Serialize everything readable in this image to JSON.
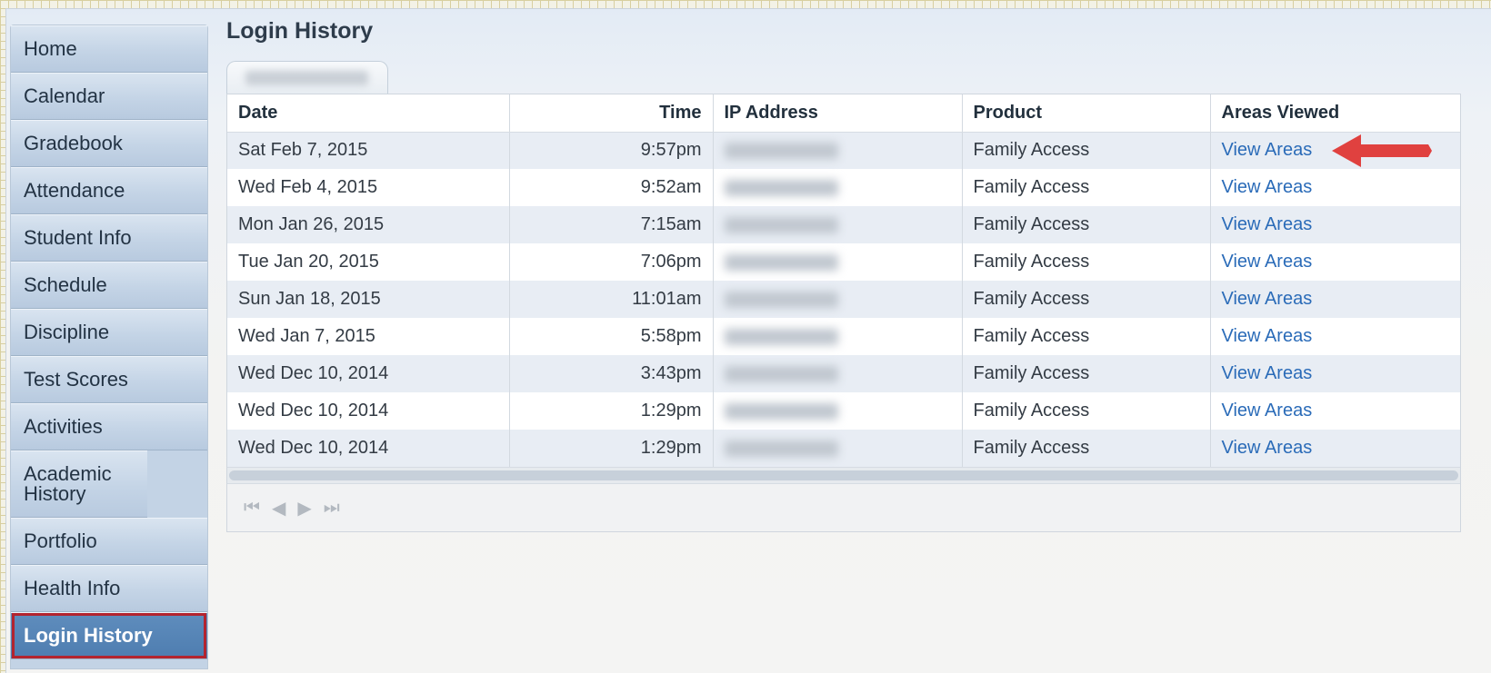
{
  "sidebar": {
    "items": [
      {
        "label": "Home"
      },
      {
        "label": "Calendar"
      },
      {
        "label": "Gradebook"
      },
      {
        "label": "Attendance"
      },
      {
        "label": "Student Info"
      },
      {
        "label": "Schedule"
      },
      {
        "label": "Discipline"
      },
      {
        "label": "Test Scores"
      },
      {
        "label": "Activities"
      },
      {
        "label": "Academic History"
      },
      {
        "label": "Portfolio"
      },
      {
        "label": "Health Info"
      },
      {
        "label": "Login History"
      }
    ],
    "active_item": "Login History"
  },
  "main": {
    "title": "Login History",
    "table": {
      "headers": {
        "date": "Date",
        "time": "Time",
        "ip": "IP Address",
        "product": "Product",
        "areas": "Areas Viewed"
      },
      "rows": [
        {
          "date": "Sat Feb 7, 2015",
          "time": "9:57pm",
          "product": "Family Access",
          "areas": "View Areas"
        },
        {
          "date": "Wed Feb 4, 2015",
          "time": "9:52am",
          "product": "Family Access",
          "areas": "View Areas"
        },
        {
          "date": "Mon Jan 26, 2015",
          "time": "7:15am",
          "product": "Family Access",
          "areas": "View Areas"
        },
        {
          "date": "Tue Jan 20, 2015",
          "time": "7:06pm",
          "product": "Family Access",
          "areas": "View Areas"
        },
        {
          "date": "Sun Jan 18, 2015",
          "time": "11:01am",
          "product": "Family Access",
          "areas": "View Areas"
        },
        {
          "date": "Wed Jan 7, 2015",
          "time": "5:58pm",
          "product": "Family Access",
          "areas": "View Areas"
        },
        {
          "date": "Wed Dec 10, 2014",
          "time": "3:43pm",
          "product": "Family Access",
          "areas": "View Areas"
        },
        {
          "date": "Wed Dec 10, 2014",
          "time": "1:29pm",
          "product": "Family Access",
          "areas": "View Areas"
        },
        {
          "date": "Wed Dec 10, 2014",
          "time": "1:29pm",
          "product": "Family Access",
          "areas": "View Areas"
        }
      ]
    },
    "pager_icons": [
      "first-page-icon",
      "prev-page-icon",
      "next-page-icon",
      "last-page-icon"
    ]
  },
  "colors": {
    "link": "#2a6bb8",
    "active_nav": "#4e7db0",
    "highlight_border": "#b3242f",
    "annotation_arrow": "#e0413f"
  }
}
